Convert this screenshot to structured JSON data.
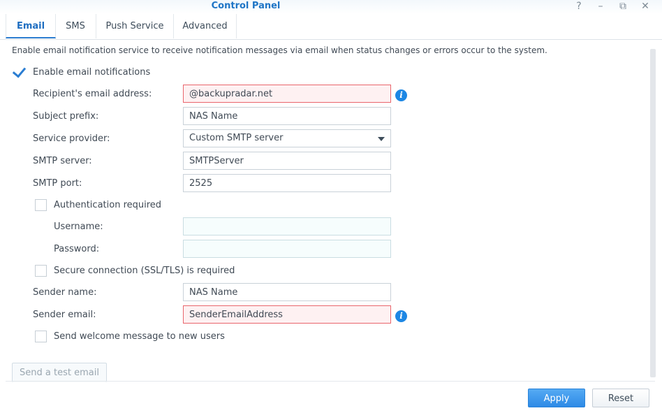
{
  "window": {
    "title": "Control Panel",
    "help_symbol": "?",
    "minimize_symbol": "–",
    "restore_symbol": "⧉",
    "close_symbol": "✕"
  },
  "tabs": [
    {
      "label": "Email",
      "active": true
    },
    {
      "label": "SMS",
      "active": false
    },
    {
      "label": "Push Service",
      "active": false
    },
    {
      "label": "Advanced",
      "active": false
    }
  ],
  "email": {
    "description": "Enable email notification service to receive notification messages via email when status changes or errors occur to the system.",
    "enable_label": "Enable email notifications",
    "enable_checked": true,
    "recipient": {
      "label": "Recipient's email address:",
      "value": "@backupradar.net"
    },
    "subject_prefix": {
      "label": "Subject prefix:",
      "value": "NAS Name"
    },
    "service_provider": {
      "label": "Service provider:",
      "value": "Custom SMTP server"
    },
    "smtp_server": {
      "label": "SMTP server:",
      "value": "SMTPServer"
    },
    "smtp_port": {
      "label": "SMTP port:",
      "value": "2525"
    },
    "auth_label": "Authentication required",
    "auth_checked": false,
    "username": {
      "label": "Username:",
      "value": ""
    },
    "password": {
      "label": "Password:",
      "value": ""
    },
    "ssl_label": "Secure connection (SSL/TLS) is required",
    "ssl_checked": false,
    "sender_name": {
      "label": "Sender name:",
      "value": "NAS Name"
    },
    "sender_email": {
      "label": "Sender email:",
      "value": "SenderEmailAddress"
    },
    "welcome_label": "Send welcome message to new users",
    "welcome_checked": false,
    "test_button": "Send a test email"
  },
  "footer": {
    "apply": "Apply",
    "reset": "Reset"
  },
  "colors": {
    "accent": "#2d8ae6",
    "error_border": "#e9656c",
    "title": "#1f75c6"
  }
}
